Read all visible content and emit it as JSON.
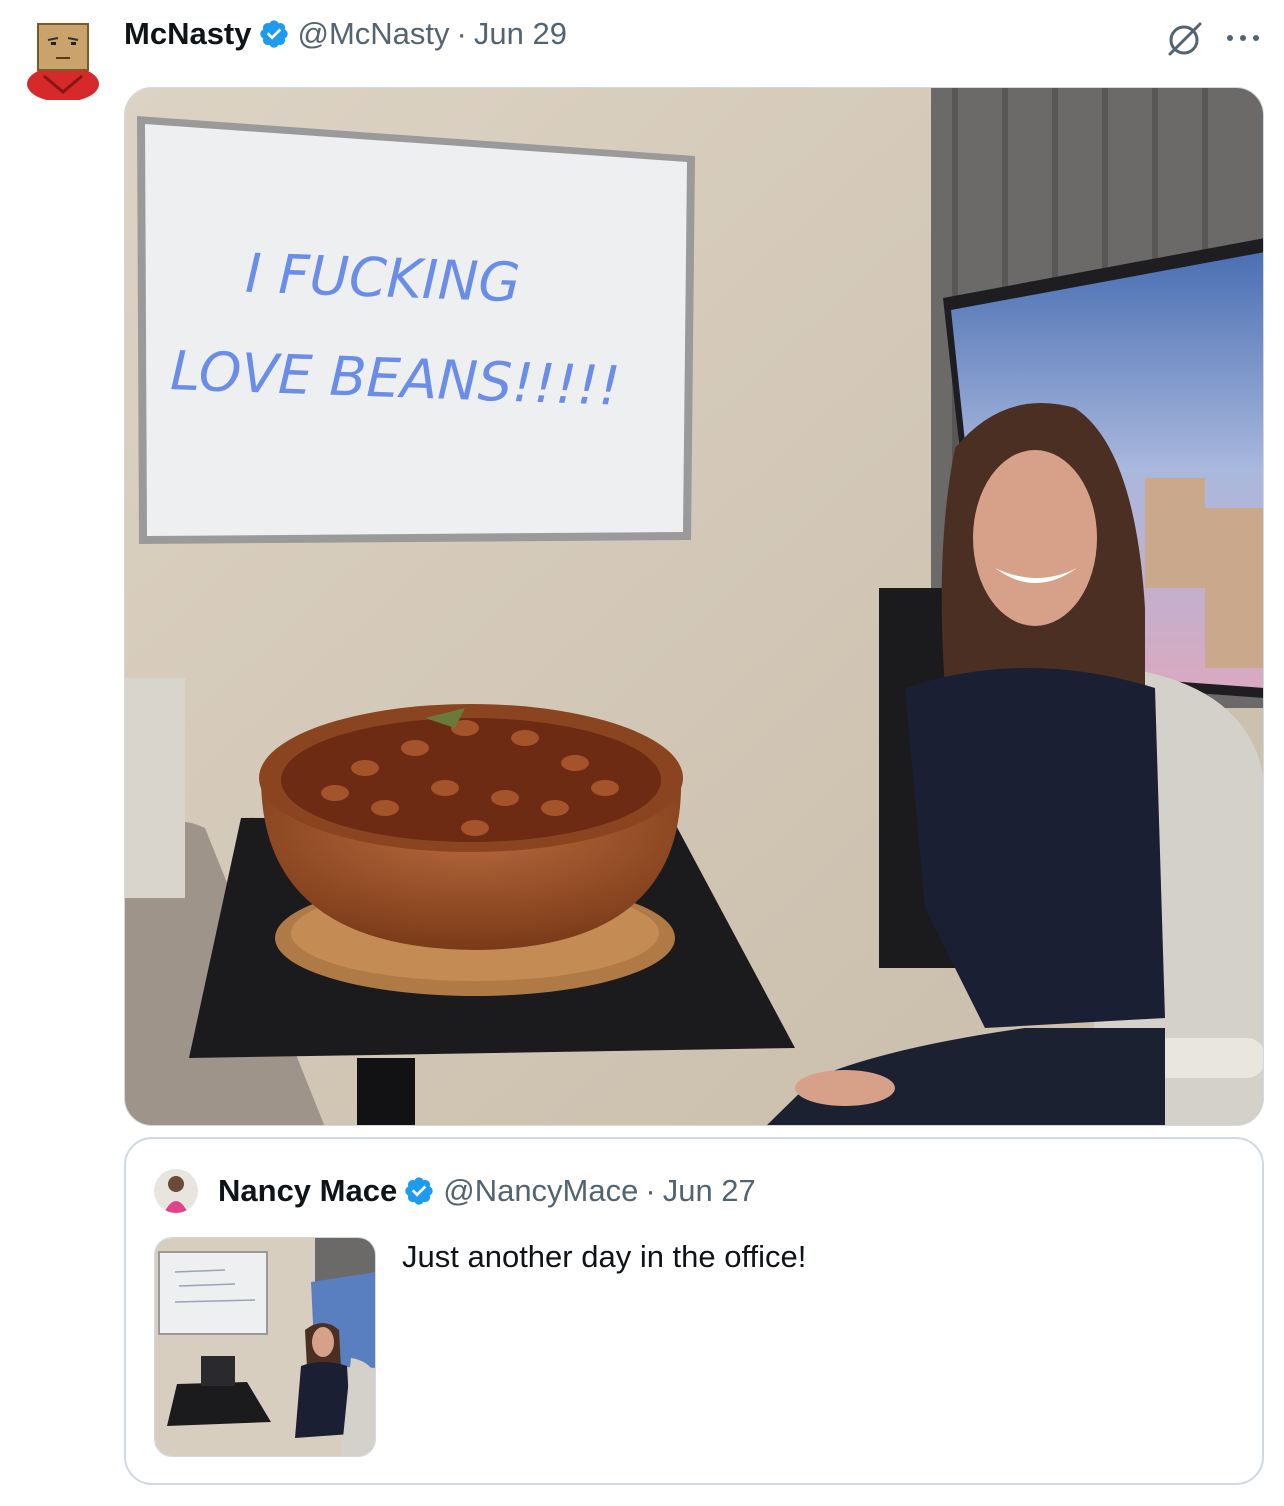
{
  "tweet": {
    "author": {
      "name": "McNasty",
      "handle": "@McNasty",
      "separator": "·",
      "date": "Jun 29",
      "verified": true,
      "avatar_icon": "boxhead-avatar"
    },
    "actions": {
      "grok_icon": "grok-icon",
      "more_icon": "more-horizontal-icon",
      "more_label": "···"
    },
    "media": {
      "whiteboard_line_1": "I FUCKING",
      "whiteboard_line_2": "LOVE BEANS!!!!!"
    }
  },
  "quoted_tweet": {
    "author": {
      "name": "Nancy Mace",
      "handle": "@NancyMace",
      "separator": "·",
      "date": "Jun 27",
      "verified": true
    },
    "text": "Just another day in the office!"
  },
  "colors": {
    "verified_blue": "#1d9bf0",
    "secondary_text": "#536471",
    "border": "#cfd9de",
    "whiteboard_ink": "#6a8de8"
  }
}
